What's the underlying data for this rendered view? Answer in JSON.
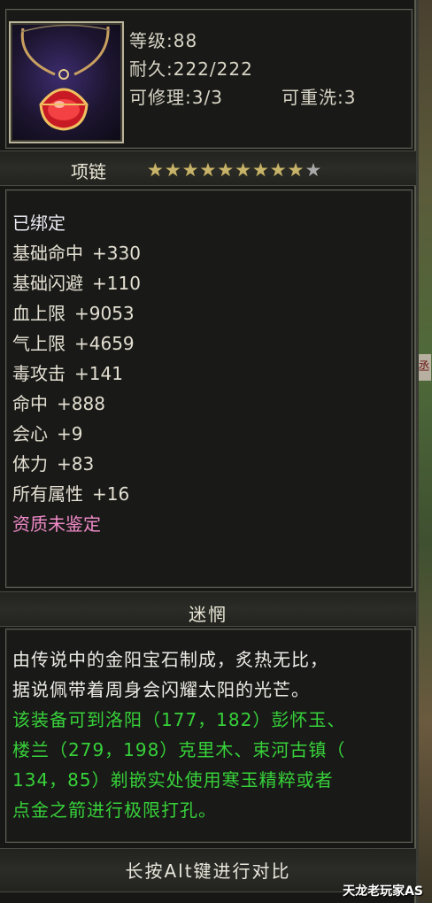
{
  "item": {
    "level": "等级:88",
    "durability": "耐久:222/222",
    "repairable": "可修理:3/3",
    "rewashable": "可重洗:3",
    "type": "项链",
    "stars_total": 10,
    "stars_filled": 9,
    "bound": "已绑定",
    "attributes": [
      {
        "name": "基础命中",
        "value": "+330"
      },
      {
        "name": "基础闪避",
        "value": "+110"
      },
      {
        "name": "血上限",
        "value": "+9053"
      },
      {
        "name": "气上限",
        "value": "+4659"
      },
      {
        "name": "毒攻击",
        "value": "+141"
      },
      {
        "name": "命中",
        "value": "+888"
      },
      {
        "name": "会心",
        "value": "+9"
      },
      {
        "name": "体力",
        "value": "+83"
      },
      {
        "name": "所有属性",
        "value": "+16"
      }
    ],
    "quality": "资质未鉴定",
    "name": "迷惘",
    "description_lines": [
      "由传说中的金阳宝石制成，炙热无比，",
      "据说佩带着周身会闪耀太阳的光芒。"
    ],
    "hint_lines": [
      "该装备可到洛阳（177，182）彭怀玉、",
      "楼兰（279，198）克里木、束河古镇（",
      "134，85）剃嵌实处使用寒玉精粹或者",
      "点金之箭进行极限打孔。"
    ],
    "footer": "长按Alt键进行对比"
  },
  "colors": {
    "text": "#e3dfd2",
    "hint_green": "#37d13a",
    "quality_pink": "#f08ac8",
    "star_gold": "#c7b46a"
  },
  "icons": [
    "necklace-item-icon",
    "star-icon"
  ],
  "watermark": "天龙老玩家AS"
}
